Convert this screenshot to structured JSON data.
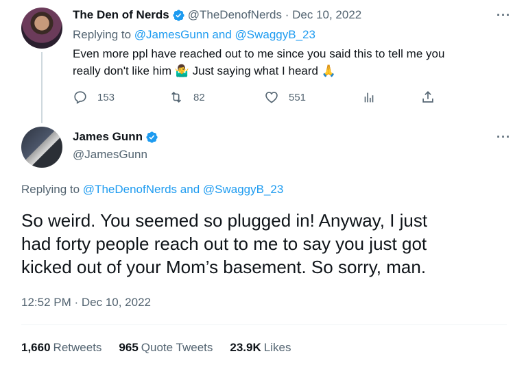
{
  "tweet1": {
    "author_name": "The Den of Nerds",
    "meta": "@TheDenofNerds · Dec 10, 2022",
    "replying_prefix": "Replying to",
    "replying_mentions": "@JamesGunn and @SwaggyB_23",
    "text_line1": "Even more ppl have reached out to me since you said this to tell me you",
    "text_line2": "really don't like him 🤷‍♂️ Just saying what I heard 🙏",
    "replies": "153",
    "retweets": "82",
    "likes": "551",
    "more_label": "···"
  },
  "tweet2": {
    "author_name": "James Gunn",
    "handle": "@JamesGunn",
    "replying_prefix": "Replying to",
    "replying_mentions": "@TheDenofNerds and @SwaggyB_23",
    "text_line1": "So weird. You seemed so plugged in! Anyway, I just",
    "text_line2": "had forty people reach out to me to say you just got",
    "text_line3": "kicked out of your Mom’s basement. So sorry, man.",
    "timestamp": "12:52 PM · Dec 10, 2022",
    "more_label": "···"
  },
  "stats": {
    "retweets_count": "1,660",
    "retweets_label": "Retweets",
    "quotes_count": "965",
    "quotes_label": "Quote Tweets",
    "likes_count": "23.9K",
    "likes_label": "Likes"
  },
  "colors": {
    "accent": "#1d9bf0",
    "secondary_text": "#536471",
    "primary_text": "#0f1419"
  }
}
